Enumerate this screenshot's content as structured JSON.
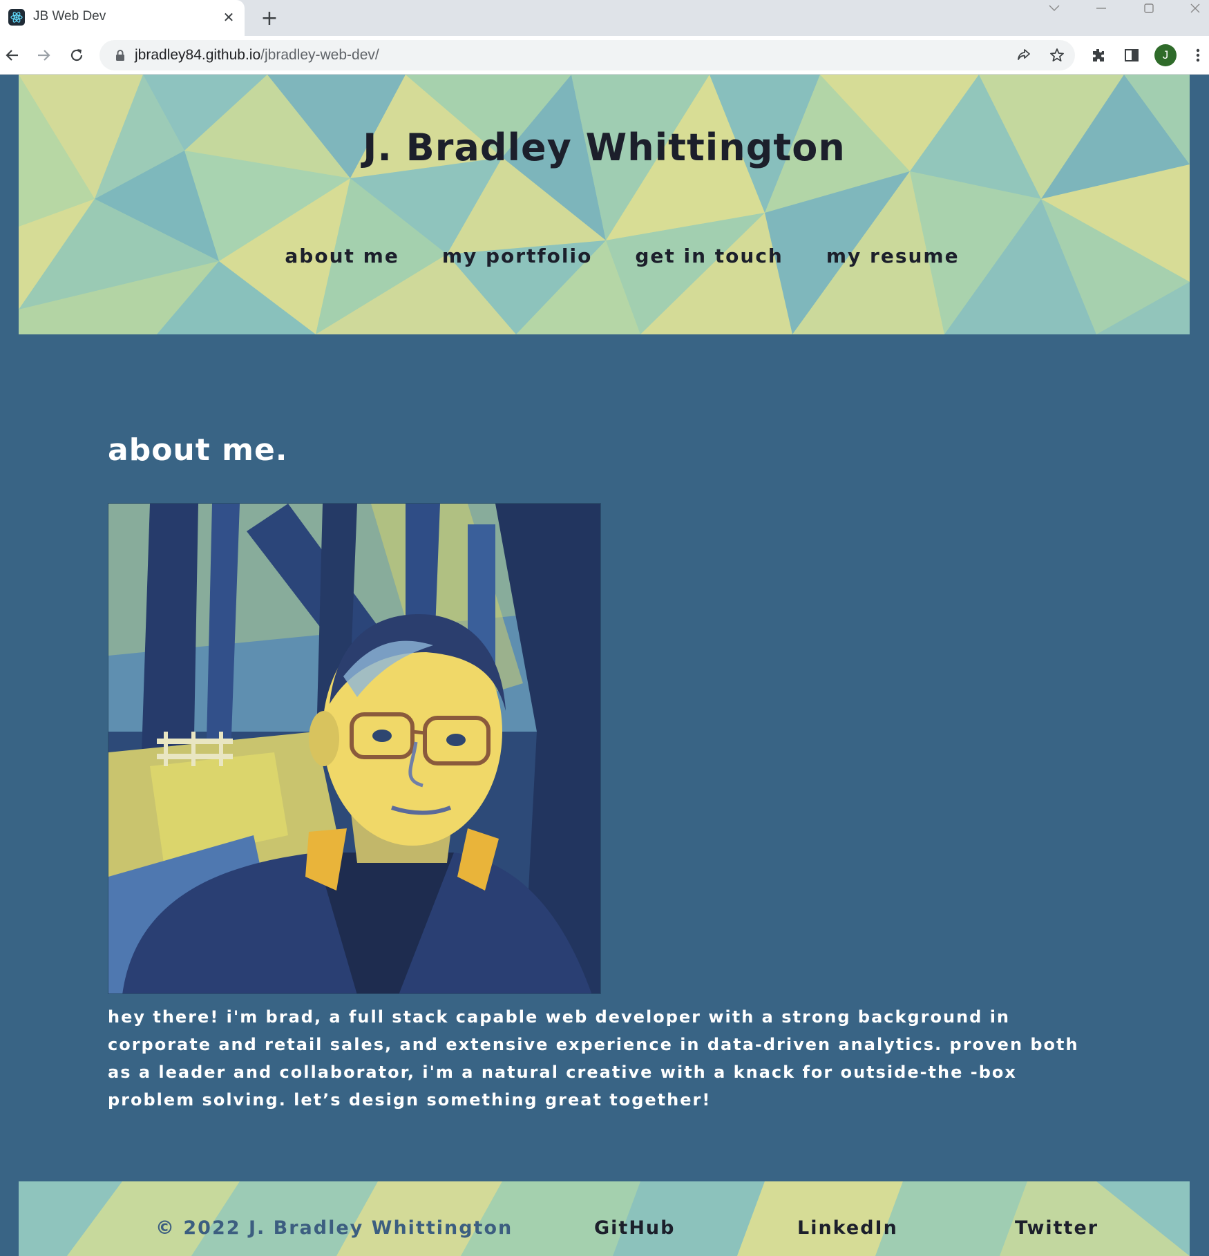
{
  "browser": {
    "tab_title": "JB Web Dev",
    "url_host": "jbradley84.github.io",
    "url_path": "/jbradley-web-dev/",
    "profile_initial": "J"
  },
  "header": {
    "title": "J. Bradley Whittington",
    "nav": [
      "about me",
      "my portfolio",
      "get in touch",
      "my resume"
    ]
  },
  "about": {
    "heading": "about me.",
    "bio": "hey there! i'm brad, a full stack capable web developer with a strong background in corporate and retail sales, and extensive experience in data-driven analytics. proven both as a leader and collaborator, i'm a natural creative with a knack for outside-the -box problem solving. let’s design something great together!"
  },
  "footer": {
    "copyright": "© 2022 J. Bradley Whittington",
    "links": [
      "GitHub",
      "LinkedIn",
      "Twitter"
    ]
  },
  "colors": {
    "page_bg": "#396485",
    "poly_yellow": "#d8dc96",
    "poly_teal": "#8ec4c0",
    "poly_green": "#a7d4ae",
    "text_dark": "#1c1f2b"
  }
}
